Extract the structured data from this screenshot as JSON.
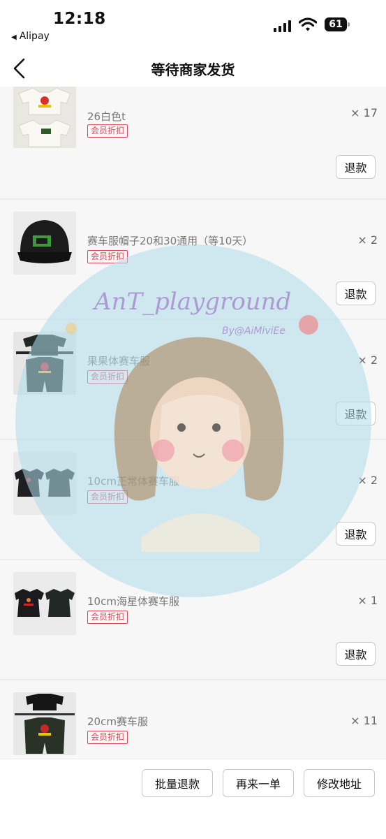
{
  "status_bar": {
    "time": "12:18",
    "back_app": "Alipay",
    "battery": "61"
  },
  "nav": {
    "title": "等待商家发货"
  },
  "items": [
    {
      "name": "26白色t",
      "badge": "会员折扣",
      "qty": "× 17",
      "refund": "退款"
    },
    {
      "name": "赛车服帽子20和30通用（等10天）",
      "badge": "会员折扣",
      "qty": "× 2",
      "refund": "退款"
    },
    {
      "name": "果果体赛车服",
      "badge": "会员折扣",
      "qty": "× 2",
      "refund": "退款"
    },
    {
      "name": "10cm正常体赛车服",
      "badge": "会员折扣",
      "qty": "× 2",
      "refund": "退款"
    },
    {
      "name": "10cm海星体赛车服",
      "badge": "会员折扣",
      "qty": "× 1",
      "refund": "退款"
    },
    {
      "name": "20cm赛车服",
      "badge": "会员折扣",
      "qty": "× 11"
    }
  ],
  "watermark": {
    "title": "AnT_playground",
    "subtitle": "By@AiMiviEe"
  },
  "bottom": {
    "batch_refund": "批量退款",
    "reorder": "再来一单",
    "modify_address": "修改地址"
  },
  "colors": {
    "badge_red": "#e0485a",
    "watermark_blue": "#afdceb"
  }
}
